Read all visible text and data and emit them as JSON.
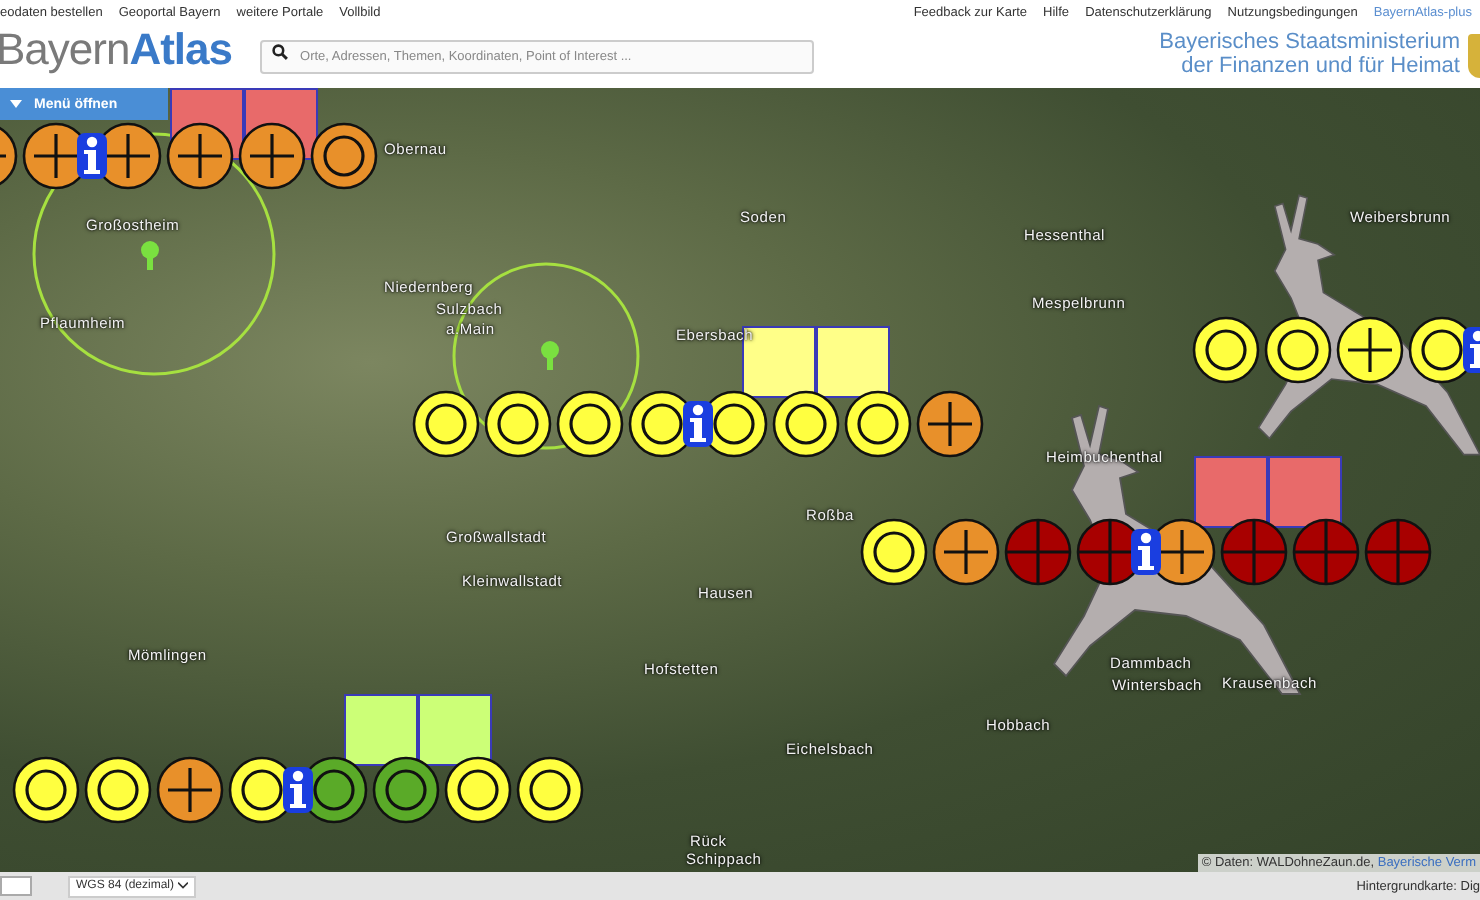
{
  "top_links": [
    {
      "label": "eodaten bestellen"
    },
    {
      "label": "Geoportal Bayern"
    },
    {
      "label": "weitere Portale"
    },
    {
      "label": "Vollbild"
    }
  ],
  "header_links": [
    {
      "label": "Feedback zur Karte",
      "kind": "plain"
    },
    {
      "label": "Hilfe",
      "kind": "plain"
    },
    {
      "label": "Datenschutzerklärung",
      "kind": "plain"
    },
    {
      "label": "Nutzungsbedingungen",
      "kind": "plain"
    },
    {
      "label": "BayernAtlas-plus",
      "kind": "accent"
    }
  ],
  "logo": {
    "part_1": "Bayern",
    "part_2": "Atlas"
  },
  "search": {
    "placeholder": "Orte, Adressen, Themen, Koordinaten, Point of Interest ..."
  },
  "ministry": [
    "Bayerisches Staatsministerium",
    "der Finanzen und für Heimat"
  ],
  "menu_button": {
    "label": "Menü öffnen"
  },
  "map": {
    "place_labels": [
      {
        "text": "Obernau"
      },
      {
        "text": "Großostheim"
      },
      {
        "text": "Pflaumheim"
      },
      {
        "text": "Niedernberg"
      },
      {
        "text": "Sulzbach"
      },
      {
        "text": "a.Main"
      },
      {
        "text": "Ebersbach"
      },
      {
        "text": "Soden"
      },
      {
        "text": "Hessenthal"
      },
      {
        "text": "Mespelbrunn"
      },
      {
        "text": "Weibersbrunn"
      },
      {
        "text": "Heimbuchenthal"
      },
      {
        "text": "Großwallstadt"
      },
      {
        "text": "Kleinwallstadt"
      },
      {
        "text": "Hausen"
      },
      {
        "text": "Mömlingen"
      },
      {
        "text": "Hofstetten"
      },
      {
        "text": "Eichelsbach"
      },
      {
        "text": "Hobbach"
      },
      {
        "text": "Dammbach"
      },
      {
        "text": "Wintersbach"
      },
      {
        "text": "Krausenbach"
      },
      {
        "text": "Roßba"
      },
      {
        "text": "Rück"
      },
      {
        "text": "Schippach"
      }
    ],
    "marker_rows": [
      {
        "boxes": [
          {
            "color": "#e86a6a"
          },
          {
            "color": "#e86a6a"
          }
        ],
        "markers": [
          {
            "kind": "plus",
            "color": "#e8902a"
          },
          {
            "kind": "plus",
            "color": "#e8902a"
          },
          {
            "kind": "info"
          },
          {
            "kind": "plus",
            "color": "#e8902a"
          },
          {
            "kind": "plus",
            "color": "#e8902a"
          },
          {
            "kind": "plus",
            "color": "#e8902a"
          },
          {
            "kind": "ring",
            "color": "#e8902a"
          }
        ]
      },
      {
        "boxes": [
          {
            "color": "#ffff88"
          },
          {
            "color": "#ffff88"
          }
        ],
        "markers": [
          {
            "kind": "ring",
            "color": "#ffff40"
          },
          {
            "kind": "ring",
            "color": "#ffff40"
          },
          {
            "kind": "ring",
            "color": "#ffff40"
          },
          {
            "kind": "ring",
            "color": "#ffff40"
          },
          {
            "kind": "info"
          },
          {
            "kind": "ring",
            "color": "#ffff40"
          },
          {
            "kind": "ring",
            "color": "#ffff40"
          },
          {
            "kind": "ring",
            "color": "#ffff40"
          },
          {
            "kind": "plus",
            "color": "#e8902a"
          }
        ]
      },
      {
        "markers": [
          {
            "kind": "ring",
            "color": "#ffff40"
          },
          {
            "kind": "ring",
            "color": "#ffff40"
          },
          {
            "kind": "plus",
            "color": "#ffff40"
          },
          {
            "kind": "ring",
            "color": "#ffff40"
          },
          {
            "kind": "info"
          }
        ]
      },
      {
        "boxes": [
          {
            "color": "#e86a6a"
          },
          {
            "color": "#e86a6a"
          }
        ],
        "markers": [
          {
            "kind": "ring",
            "color": "#ffff40"
          },
          {
            "kind": "plus",
            "color": "#e8902a"
          },
          {
            "kind": "cross",
            "color": "#a80000"
          },
          {
            "kind": "cross",
            "color": "#a80000"
          },
          {
            "kind": "info"
          },
          {
            "kind": "plus",
            "color": "#e8902a"
          },
          {
            "kind": "cross",
            "color": "#a80000"
          },
          {
            "kind": "cross",
            "color": "#a80000"
          },
          {
            "kind": "cross",
            "color": "#a80000"
          }
        ]
      },
      {
        "boxes": [
          {
            "color": "#ccff77"
          },
          {
            "color": "#ccff77"
          }
        ],
        "markers": [
          {
            "kind": "ring",
            "color": "#ffff40"
          },
          {
            "kind": "ring",
            "color": "#ffff40"
          },
          {
            "kind": "plus",
            "color": "#e8902a"
          },
          {
            "kind": "ring",
            "color": "#ffff40"
          },
          {
            "kind": "info"
          },
          {
            "kind": "ring",
            "color": "#5aaa28"
          },
          {
            "kind": "ring",
            "color": "#5aaa28"
          },
          {
            "kind": "ring",
            "color": "#ffff40"
          },
          {
            "kind": "ring",
            "color": "#ffff40"
          }
        ]
      }
    ],
    "attribution": {
      "text": "© Daten: WALDohneZaun.de,",
      "link": "Bayerische Verm"
    }
  },
  "bottom_bar": {
    "crs_select": "WGS 84 (dezimal)",
    "background_note": "Hintergrundkarte: Dig"
  }
}
